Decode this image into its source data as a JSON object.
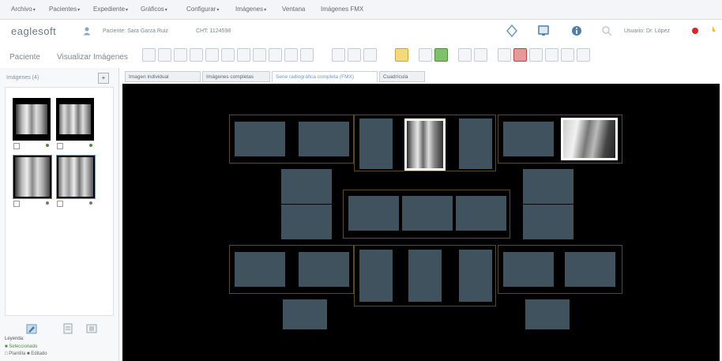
{
  "menu": {
    "items": [
      {
        "label": "Archivo",
        "caret": "▾"
      },
      {
        "label": "Pacientes",
        "caret": "▾"
      },
      {
        "label": "Expediente",
        "caret": "▾"
      },
      {
        "label": "Gráficos",
        "caret": "▾"
      },
      {
        "label": "Configurar",
        "caret": "▾"
      },
      {
        "label": "Imágenes",
        "caret": "▾"
      },
      {
        "label": "Ventana",
        "caret": ""
      },
      {
        "label": "Imágenes FMX",
        "caret": ""
      }
    ]
  },
  "context": {
    "logo": "eaglesoft",
    "patient_name": "Paciente: Sara Garza Ruiz",
    "patient_id": "CHT: 1124598",
    "user_label": "Usuario: Dr. López"
  },
  "toolbar": {
    "label1": "Paciente",
    "label2": "Visualizar Imágenes"
  },
  "sidebar": {
    "title": "Imágenes (4)",
    "button": "+",
    "legend_title": "Leyenda:",
    "legend_lines": [
      "■ Seleccionado",
      "□ Plantilla   ■ Editado"
    ]
  },
  "tabs": [
    {
      "label": "Imagen individual",
      "active": false
    },
    {
      "label": "Imágenes completas",
      "active": false
    },
    {
      "label": "Serie radiográfica completa (FMX)",
      "active": true
    },
    {
      "label": "Cuadrícula",
      "active": false
    }
  ],
  "colors": {
    "canvas_bg": "#000000",
    "slot_empty": "#3f525e",
    "group_border": "#5a4a2a",
    "accent_tab": "#6d9ac1"
  },
  "icons": {
    "patient": "person-icon",
    "network": "network-icon",
    "monitor": "monitor-icon",
    "help": "info-icon",
    "record": "record-icon"
  }
}
